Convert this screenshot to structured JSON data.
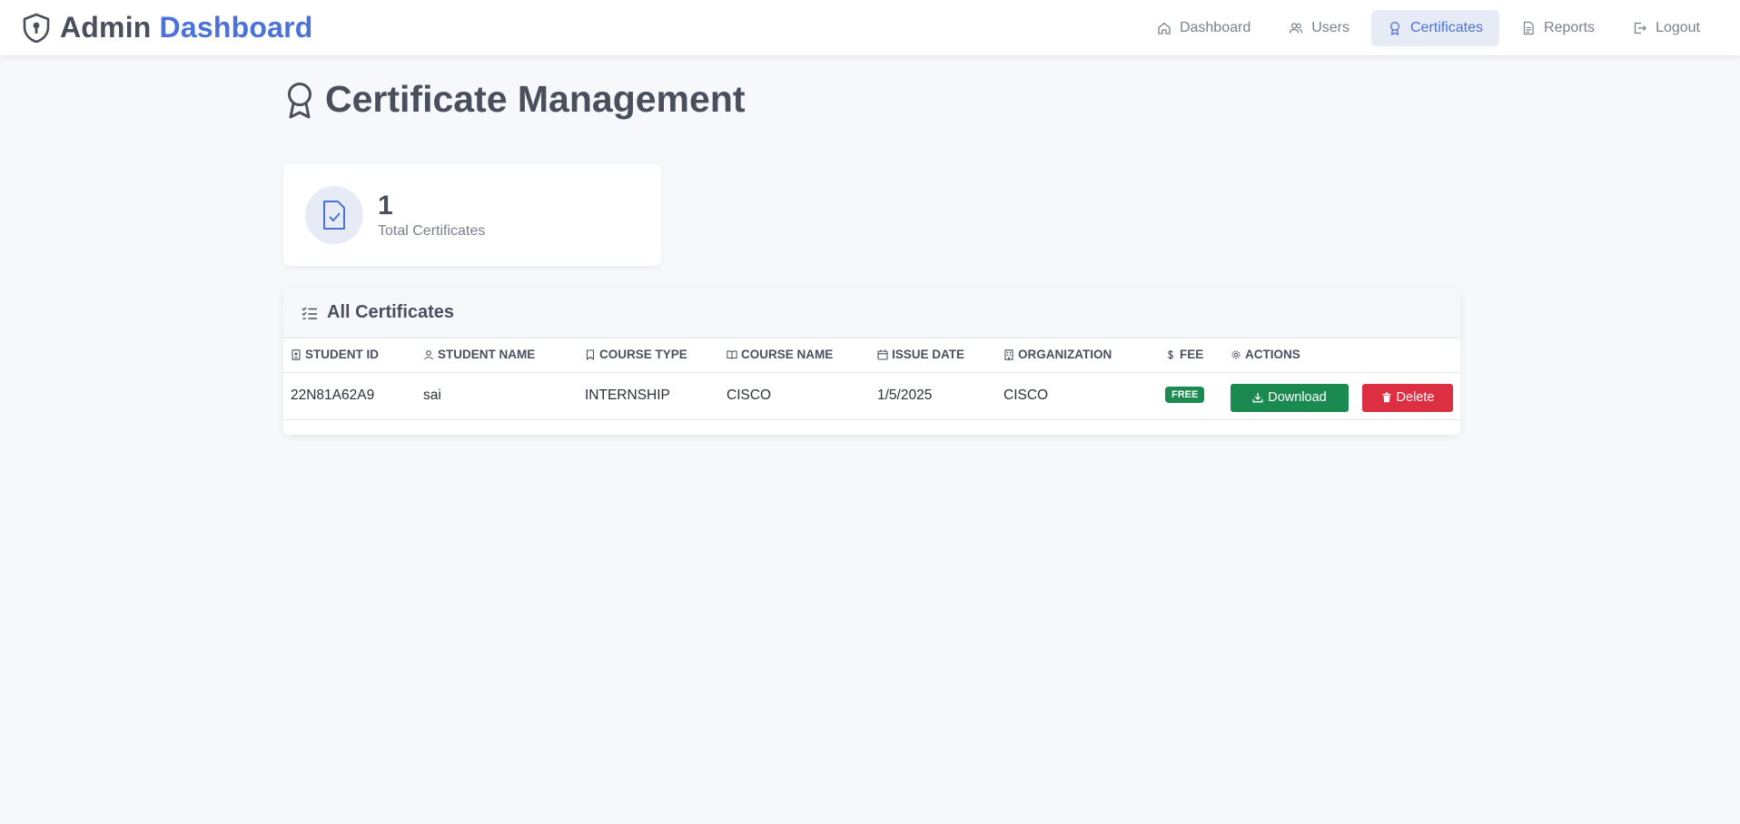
{
  "brand": {
    "title": "Admin",
    "accent": "Dashboard",
    "icon": "shield-keyhole-icon"
  },
  "nav": [
    {
      "label": "Dashboard",
      "icon": "home-icon",
      "active": false
    },
    {
      "label": "Users",
      "icon": "users-icon",
      "active": false
    },
    {
      "label": "Certificates",
      "icon": "award-icon",
      "active": true
    },
    {
      "label": "Reports",
      "icon": "file-text-icon",
      "active": false
    },
    {
      "label": "Logout",
      "icon": "logout-icon",
      "active": false
    }
  ],
  "page": {
    "title": "Certificate Management",
    "icon": "award-icon"
  },
  "stat": {
    "value": "1",
    "label": "Total Certificates",
    "icon": "file-check-icon"
  },
  "table_card": {
    "title": "All Certificates",
    "icon": "list-check-icon"
  },
  "table": {
    "columns": [
      {
        "label": "STUDENT ID",
        "icon": "id-badge-icon"
      },
      {
        "label": "STUDENT NAME",
        "icon": "person-icon"
      },
      {
        "label": "COURSE TYPE",
        "icon": "bookmark-icon"
      },
      {
        "label": "COURSE NAME",
        "icon": "book-icon"
      },
      {
        "label": "ISSUE DATE",
        "icon": "calendar-icon"
      },
      {
        "label": "ORGANIZATION",
        "icon": "building-icon"
      },
      {
        "label": "FEE",
        "icon": "dollar-icon"
      },
      {
        "label": "ACTIONS",
        "icon": "gear-icon"
      }
    ],
    "rows": [
      {
        "student_id": "22N81A62A9",
        "student_name": "sai",
        "course_type": "INTERNSHIP",
        "course_name": "CISCO",
        "issue_date": "1/5/2025",
        "organization": "CISCO",
        "fee": "FREE",
        "download_label": "Download",
        "delete_label": "Delete"
      }
    ]
  },
  "colors": {
    "accent": "#4a72d8",
    "success": "#1a8a50",
    "danger": "#dc2f42",
    "background": "#f7f8fb"
  }
}
